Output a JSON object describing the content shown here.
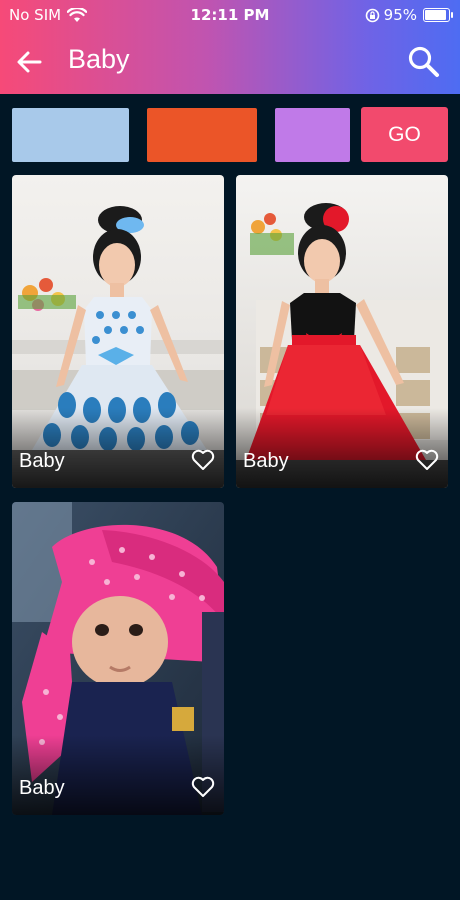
{
  "status_bar": {
    "carrier": "No SIM",
    "time": "12:11 PM",
    "battery": "95%",
    "battery_level": 0.95
  },
  "appbar": {
    "title": "Baby",
    "back_icon": "arrow-left-icon",
    "search_icon": "search-icon"
  },
  "filters": {
    "swatches": [
      {
        "name": "light-blue",
        "color": "#a8c9ea"
      },
      {
        "name": "orange",
        "color": "#eb5528"
      },
      {
        "name": "purple",
        "color": "#c07ae8"
      }
    ],
    "go_label": "GO",
    "go_color": "#f24a6d"
  },
  "gallery": [
    {
      "label": "Baby",
      "subject": "girl-blue-dress",
      "icon": "heart-outline-icon"
    },
    {
      "label": "Baby",
      "subject": "girl-red-dress",
      "icon": "heart-outline-icon"
    },
    {
      "label": "Baby",
      "subject": "infant-pink-scarf",
      "icon": "heart-outline-icon"
    }
  ],
  "colors": {
    "background": "#011625",
    "header_gradient": [
      "#f64a78",
      "#c054b0",
      "#6f63e6",
      "#4e6cf2"
    ]
  }
}
